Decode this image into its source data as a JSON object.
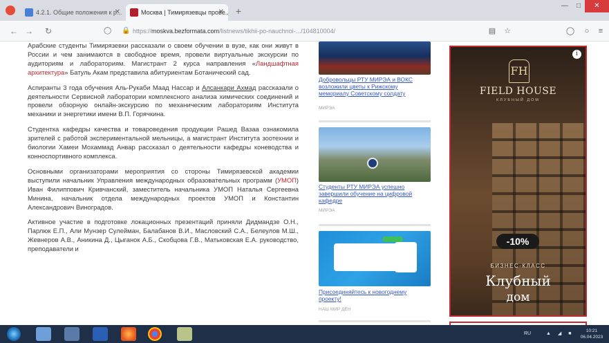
{
  "browser": {
    "tabs": [
      {
        "title": "4.2.1. Общие положения к р...",
        "close": "✕"
      },
      {
        "title": "Москва | Тимирязевцы прове...",
        "close": "✕"
      }
    ],
    "new_tab": "+",
    "url_prefix": "https://",
    "url_domain": "moskva.bezformata.com",
    "url_path": "/listnews/tikhii-po-nauchnoi-.../104810004/"
  },
  "article": {
    "p1": "Арабские студенты Тимирязевки рассказали о своем обучении в вузе, как они живут в России и чем занимаются в свободное время, провели виртуальные экскурсии по аудиториям и лабораториям. Магистрант 2 курса направления «",
    "p1_link": "Ландшафтная архитектура",
    "p1_end": "» Батуль Акам представила абитуриентам Ботанический сад.",
    "p2_start": "Аспиранты 3 года обучения Аль-Рукаби Маад Нассар и ",
    "p2_ul": "Алсанкари Ахмад",
    "p2_end": " рассказали о деятельности Сервисной лаборатории комплексного анализа химических соединений и провели обзорную онлайн-экскурсию по механическим лабораториям Института механики и энергетики имени В.П. Горячкина.",
    "p3": "Студентка кафедры качества и товароведения продукции Рашед Вазаа ознакомила зрителей с работой экспериментальной мельницы, а магистрант Института зоотехнии и биологии Хамеи Мохаммад Анвар рассказал о деятельности кафедры коневодства и конноспортивного комплекса.",
    "p4_start": "Основными организаторами мероприятия со стороны Тимирязевской академии выступили начальник Управления международных образовательных программ (",
    "p4_link": "УМОП",
    "p4_end": ") Иван Филиппович Кривчанский, заместитель начальника УМОП Наталья Сергеевна Минина, начальник отдела международных проектов УМОП и Константин Александрович Виноградов.",
    "p5": "Активное участие в подготовке локационных презентаций приняли Дидмандзе О.Н., Парлюк Е.П., Али Мунзер Сулейман, Балабанов В.И., Масловский С.А., Белеулов М.Ш., Жевнеров А.В., Аникина Д., Цыганок А.Б., Скобцова Г.В., Матьковская Е.А. руководство, преподаватели и"
  },
  "news": [
    {
      "title": "Добровольцы РТУ МИРЭА и ВОКС возложили цветы к Рижскому мемориалу Советскому солдату",
      "meta": "МИРЭА"
    },
    {
      "title": "Студенты РТУ МИРЭА успешно завершили обучение на цифровой кафедре",
      "meta": "МИРЭА"
    },
    {
      "title": "Присоединяйтесь к новогоднему проекту!",
      "meta": "НАШ МИР ДЕН"
    }
  ],
  "ad": {
    "info": "i",
    "monogram": "FH",
    "brand": "FIELD HOUSE",
    "subtitle": "клубный дом",
    "discount": "-10%",
    "class": "БИЗНЕС-КЛАСС",
    "line1": "Клубный",
    "line2": "дом"
  },
  "taskbar": {
    "lang": "RU",
    "tray": "▲ ◢ ■",
    "time": "10:21",
    "date": "06.04.2023"
  },
  "colors": {
    "link_red": "#c0262d",
    "link_blue": "#3557c6",
    "ad_border": "#c22a33",
    "taskbar": "#1f2f47"
  }
}
